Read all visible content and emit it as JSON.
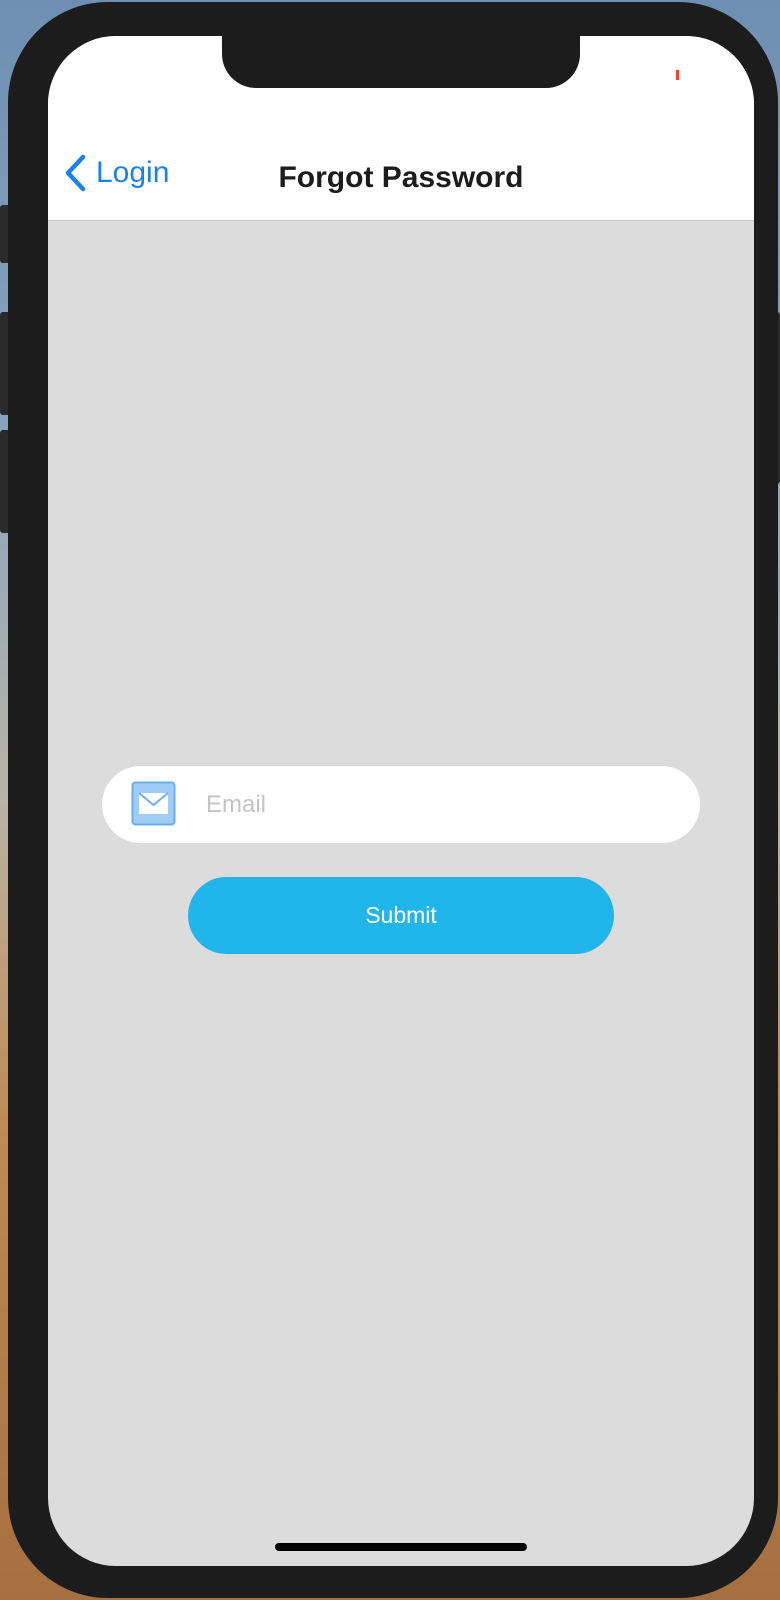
{
  "navbar": {
    "back_label": "Login",
    "title": "Forgot Password",
    "back_icon": "chevron-left-icon"
  },
  "form": {
    "email_placeholder": "Email",
    "email_value": "",
    "email_icon": "mail-icon",
    "submit_label": "Submit"
  },
  "colors": {
    "accent": "#1a82ec",
    "button": "#20b6ec",
    "background": "#dcdcdd"
  }
}
